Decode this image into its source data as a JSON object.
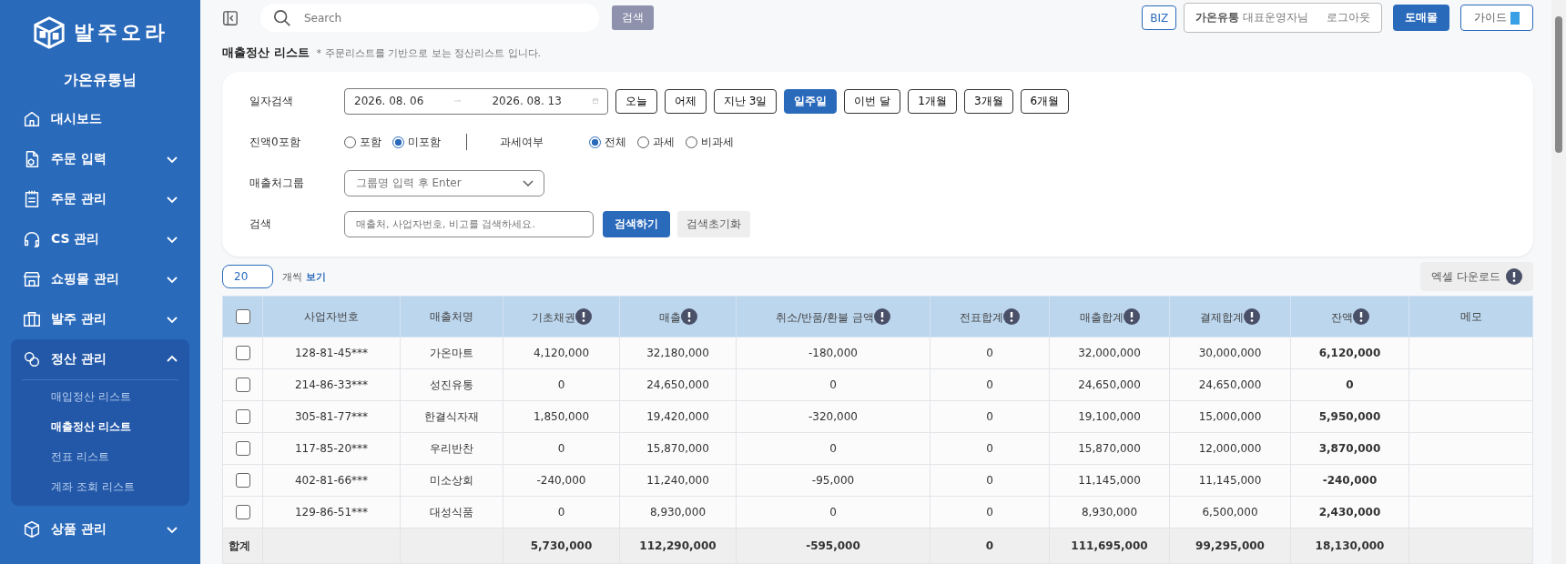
{
  "sidebar": {
    "logo_text": "발주오라",
    "user_name": "가온유통님",
    "items": [
      {
        "label": "대시보드"
      },
      {
        "label": "주문 입력",
        "expanded": false
      },
      {
        "label": "주문 관리",
        "expanded": false
      },
      {
        "label": "CS 관리",
        "expanded": false
      },
      {
        "label": "쇼핑몰 관리",
        "expanded": false
      },
      {
        "label": "발주 관리",
        "expanded": false
      },
      {
        "label": "정산 관리",
        "expanded": true,
        "children": [
          {
            "label": "매입정산 리스트",
            "selected": false
          },
          {
            "label": "매출정산 리스트",
            "selected": true
          },
          {
            "label": "전표 리스트",
            "selected": false
          },
          {
            "label": "계좌 조회 리스트",
            "selected": false
          }
        ]
      },
      {
        "label": "상품 관리",
        "expanded": false
      }
    ]
  },
  "topbar": {
    "search": {
      "placeholder": "Search"
    },
    "search_button": "검색",
    "biz": "BIZ",
    "user": {
      "company": "가온유통",
      "role": "대표운영자님",
      "logout": "로그아웃"
    },
    "wholesale_button": "도매몰",
    "guide_button": "가이드"
  },
  "page": {
    "title": "매출정산 리스트",
    "note": "* 주문리스트를 기반으로 보는 정산리스트 입니다."
  },
  "filters": {
    "date": {
      "label": "일자검색",
      "start": "2026. 08. 06",
      "end": "2026. 08. 13",
      "presets": [
        {
          "label": "오늘",
          "selected": false
        },
        {
          "label": "어제",
          "selected": false
        },
        {
          "label": "지난 3일",
          "selected": false
        },
        {
          "label": "일주일",
          "selected": true
        },
        {
          "label": "이번 달",
          "selected": false
        },
        {
          "label": "1개월",
          "selected": false
        },
        {
          "label": "3개월",
          "selected": false
        },
        {
          "label": "6개월",
          "selected": false
        }
      ]
    },
    "zero_balance": {
      "label": "진액0포함",
      "options": [
        {
          "label": "포함",
          "selected": false
        },
        {
          "label": "미포함",
          "selected": true
        }
      ]
    },
    "tax": {
      "label": "과세여부",
      "options": [
        {
          "label": "전체",
          "selected": true
        },
        {
          "label": "과세",
          "selected": false
        },
        {
          "label": "비과세",
          "selected": false
        }
      ]
    },
    "group": {
      "label": "매출처그룹",
      "placeholder": "그룹명 입력 후 Enter"
    },
    "search": {
      "label": "검색",
      "placeholder": "매출처, 사업자번호, 비고를 검색하세요.",
      "submit": "검색하기",
      "reset": "검색초기화"
    }
  },
  "list_controls": {
    "page_size": "20",
    "unit": "개씩",
    "view": "보기",
    "excel_button": "엑셀 다운로드"
  },
  "table": {
    "select_all_checked": false,
    "columns": [
      {
        "label": "사업자번호",
        "info": false
      },
      {
        "label": "매출처명",
        "info": false
      },
      {
        "label": "기초채권",
        "info": true
      },
      {
        "label": "매출",
        "info": true
      },
      {
        "label": "취소/반품/환불 금액",
        "info": true
      },
      {
        "label": "전표합계",
        "info": true
      },
      {
        "label": "매출합계",
        "info": true
      },
      {
        "label": "결제합계",
        "info": true
      },
      {
        "label": "잔액",
        "info": true
      },
      {
        "label": "메모",
        "info": false
      }
    ],
    "rows": [
      {
        "checked": false,
        "cells": [
          "128-81-45***",
          "가온마트",
          "4,120,000",
          "32,180,000",
          "-180,000",
          "0",
          "32,000,000",
          "30,000,000",
          "6,120,000"
        ]
      },
      {
        "checked": false,
        "cells": [
          "214-86-33***",
          "성진유통",
          "0",
          "24,650,000",
          "0",
          "0",
          "24,650,000",
          "24,650,000",
          "0"
        ]
      },
      {
        "checked": false,
        "cells": [
          "305-81-77***",
          "한결식자재",
          "1,850,000",
          "19,420,000",
          "-320,000",
          "0",
          "19,100,000",
          "15,000,000",
          "5,950,000"
        ]
      },
      {
        "checked": false,
        "cells": [
          "117-85-20***",
          "우리반찬",
          "0",
          "15,870,000",
          "0",
          "0",
          "15,870,000",
          "12,000,000",
          "3,870,000"
        ]
      },
      {
        "checked": false,
        "cells": [
          "402-81-66***",
          "미소상회",
          "-240,000",
          "11,240,000",
          "-95,000",
          "0",
          "11,145,000",
          "11,145,000",
          "-240,000"
        ]
      },
      {
        "checked": false,
        "cells": [
          "129-86-51***",
          "대성식품",
          "0",
          "8,930,000",
          "0",
          "0",
          "8,930,000",
          "6,500,000",
          "2,430,000"
        ]
      }
    ],
    "totals": {
      "label": "합계",
      "cells": [
        "5,730,000",
        "112,290,000",
        "-595,000",
        "0",
        "111,695,000",
        "99,295,000",
        "18,130,000"
      ]
    }
  }
}
